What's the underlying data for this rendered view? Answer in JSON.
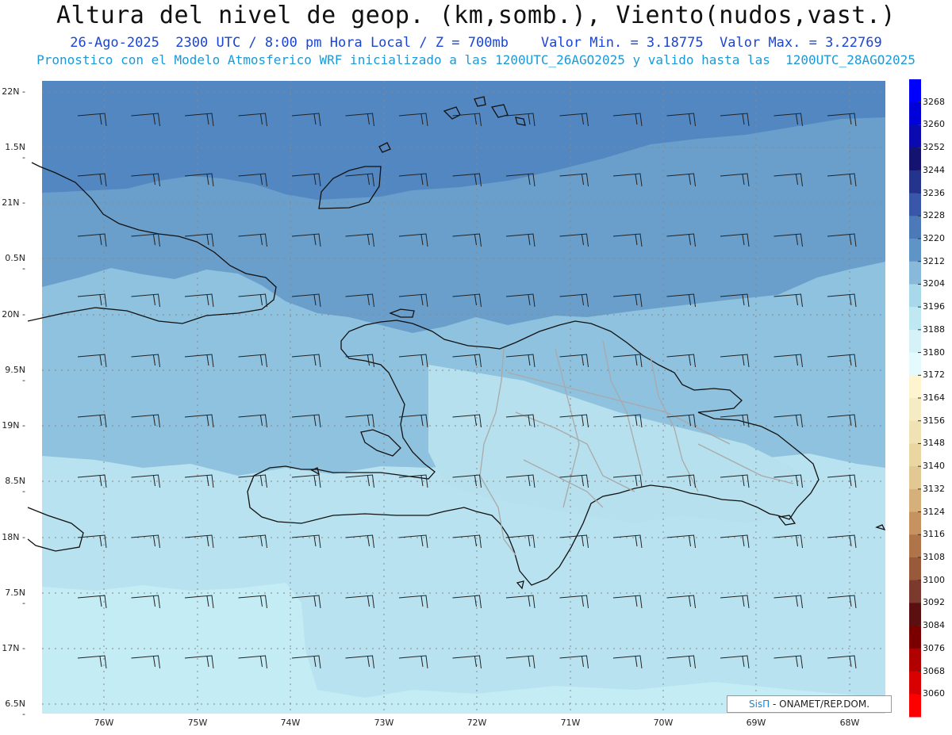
{
  "title": "Altura del nivel de geop. (km,somb.), Viento(nudos,vast.)",
  "subtitle_line1": "26-Ago-2025  2300 UTC / 8:00 pm Hora Local / Z = 700mb    Valor Min. = 3.18775  Valor Max. = 3.22769",
  "subtitle_line2": "Pronostico con el Modelo Atmosferico WRF inicializado a las 1200UTC_26AGO2025 y valido hasta las  1200UTC_28AGO2025",
  "lat_labels": [
    "22N",
    "1.5N",
    "21N",
    "0.5N",
    "20N",
    "9.5N",
    "19N",
    "8.5N",
    "18N",
    "7.5N",
    "17N",
    "6.5N"
  ],
  "lon_labels": [
    "76W",
    "75W",
    "74W",
    "73W",
    "72W",
    "71W",
    "70W",
    "69W",
    "68W"
  ],
  "colorbar": {
    "labels": [
      "3268",
      "3260",
      "3252",
      "3244",
      "3236",
      "3228",
      "3220",
      "3212",
      "3204",
      "3196",
      "3188",
      "3180",
      "3172",
      "3164",
      "3156",
      "3148",
      "3140",
      "3132",
      "3124",
      "3116",
      "3108",
      "3100",
      "3092",
      "3084",
      "3076",
      "3068",
      "3060"
    ],
    "colors": [
      "#0000ff",
      "#0000d8",
      "#0a0ab0",
      "#141470",
      "#24348c",
      "#3a56a8",
      "#4c7ab8",
      "#5f95c6",
      "#88b8da",
      "#a8d8ea",
      "#bfe8f2",
      "#d4f2f8",
      "#e4fafd",
      "#fff4d0",
      "#f6ecc4",
      "#f0e2b4",
      "#ead6a0",
      "#e2c892",
      "#d6b07a",
      "#c69260",
      "#b0744a",
      "#985a3a",
      "#7c3a2e",
      "#5a1010",
      "#7a0000",
      "#b00000",
      "#d80000",
      "#ff0000"
    ]
  },
  "credit": {
    "brand": "SisΠ",
    "text": " - ONAMET/REP.DOM."
  }
}
